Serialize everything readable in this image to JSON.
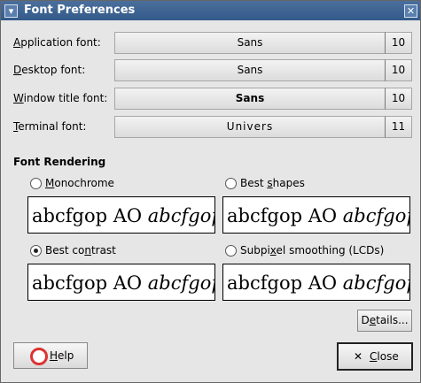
{
  "window": {
    "title": "Font Preferences",
    "menu_icon": "triangle-down-icon",
    "close_icon": "x-icon"
  },
  "fonts": {
    "application": {
      "label_pre": "",
      "label_u": "A",
      "label_post": "pplication font:",
      "name": "Sans",
      "size": "10"
    },
    "desktop": {
      "label_pre": "",
      "label_u": "D",
      "label_post": "esktop font:",
      "name": "Sans",
      "size": "10"
    },
    "window_title": {
      "label_pre": "",
      "label_u": "W",
      "label_post": "indow title font:",
      "name": "Sans",
      "size": "10"
    },
    "terminal": {
      "label_pre": "",
      "label_u": "T",
      "label_post": "erminal font:",
      "name": "Univers",
      "size": "11"
    }
  },
  "rendering": {
    "heading": "Font Rendering",
    "monochrome": {
      "pre": "",
      "u": "M",
      "post": "onochrome",
      "selected": false
    },
    "best_shapes": {
      "pre": "Best ",
      "u": "s",
      "post": "hapes",
      "selected": false
    },
    "best_contrast": {
      "pre": "Best co",
      "u": "n",
      "post": "trast",
      "selected": true
    },
    "subpixel": {
      "pre": "Subpi",
      "u": "x",
      "post": "el smoothing (LCDs)",
      "selected": false
    },
    "preview_text": "abcfgop AO ",
    "preview_italic": "abcfgop"
  },
  "buttons": {
    "details": {
      "pre": "D",
      "u": "e",
      "post": "tails..."
    },
    "help": {
      "u": "H",
      "post": "elp"
    },
    "close": {
      "u": "C",
      "post": "lose"
    }
  }
}
